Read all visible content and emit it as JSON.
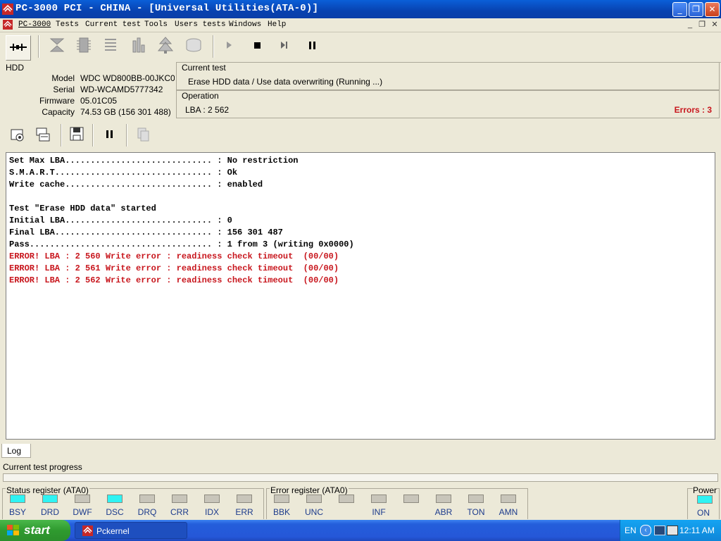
{
  "window": {
    "title": "PC-3000 PCI - CHINA - [Universal Utilities(ATA-0)]",
    "minimize": "_",
    "restore": "❐",
    "close": "✕"
  },
  "menu": {
    "items": [
      "PC-3000",
      "Tests",
      "Current test",
      "Tools",
      "Users tests",
      "Windows",
      "Help"
    ],
    "mdi_minimize": "_",
    "mdi_restore": "❐",
    "mdi_close": "✕"
  },
  "toolbar": {
    "icons": [
      "drive-connect-icon",
      "flip-icon",
      "chip-icon",
      "list-icon",
      "chart-icon",
      "tree-icon",
      "disk-icon",
      "play-icon",
      "stop-icon",
      "step-icon",
      "pause-icon"
    ]
  },
  "hdd": {
    "section_label": "HDD",
    "model_label": "Model",
    "model": "WDC WD800BB-00JKC0",
    "serial_label": "Serial",
    "serial": "WD-WCAMD5777342",
    "firmware_label": "Firmware",
    "firmware": "05.01C05",
    "capacity_label": "Capacity",
    "capacity": "74.53 GB (156 301 488)"
  },
  "current_test": {
    "label": "Current test",
    "value": "Erase HDD data / Use data overwriting (Running ...)"
  },
  "operation": {
    "label": "Operation",
    "lba": "LBA : 2 562",
    "errors": "Errors : 3"
  },
  "log": {
    "lines": [
      {
        "text": "Set Max LBA............................. : No restriction",
        "type": "info"
      },
      {
        "text": "S.M.A.R.T............................... : Ok",
        "type": "info"
      },
      {
        "text": "Write cache............................. : enabled",
        "type": "info"
      },
      {
        "text": "",
        "type": "info"
      },
      {
        "text": "Test \"Erase HDD data\" started",
        "type": "info"
      },
      {
        "text": "Initial LBA............................. : 0",
        "type": "info"
      },
      {
        "text": "Final LBA............................... : 156 301 487",
        "type": "info"
      },
      {
        "text": "Pass.................................... : 1 from 3 (writing 0x0000)",
        "type": "info"
      },
      {
        "text": "ERROR! LBA : 2 560 Write error : readiness check timeout  (00/00)",
        "type": "error"
      },
      {
        "text": "ERROR! LBA : 2 561 Write error : readiness check timeout  (00/00)",
        "type": "error"
      },
      {
        "text": "ERROR! LBA : 2 562 Write error : readiness check timeout  (00/00)",
        "type": "error"
      }
    ],
    "tab_label": "Log"
  },
  "progress": {
    "label": "Current test progress",
    "fraction": 0.0
  },
  "status_register": {
    "label": "Status register (ATA0)",
    "bits": [
      {
        "name": "BSY",
        "on": true
      },
      {
        "name": "DRD",
        "on": true
      },
      {
        "name": "DWF",
        "on": false
      },
      {
        "name": "DSC",
        "on": true
      },
      {
        "name": "DRQ",
        "on": false
      },
      {
        "name": "CRR",
        "on": false
      },
      {
        "name": "IDX",
        "on": false
      },
      {
        "name": "ERR",
        "on": false
      }
    ]
  },
  "error_register": {
    "label": "Error register (ATA0)",
    "bits": [
      {
        "name": "BBK",
        "on": false
      },
      {
        "name": "UNC",
        "on": false
      },
      {
        "name": "",
        "on": false
      },
      {
        "name": "INF",
        "on": false
      },
      {
        "name": "",
        "on": false
      },
      {
        "name": "ABR",
        "on": false
      },
      {
        "name": "TON",
        "on": false
      },
      {
        "name": "AMN",
        "on": false
      }
    ]
  },
  "power": {
    "label": "Power",
    "state": "ON"
  },
  "taskbar": {
    "start_label": "start",
    "task_label": "Pckernel",
    "lang": "EN",
    "clock": "12:11 AM"
  },
  "colors": {
    "titlebar": "#0842b0",
    "error_text": "#c8161d",
    "led_on": "#2ff3f3",
    "led_off": "#c8c5ba",
    "register_label": "#1d3b8c"
  }
}
